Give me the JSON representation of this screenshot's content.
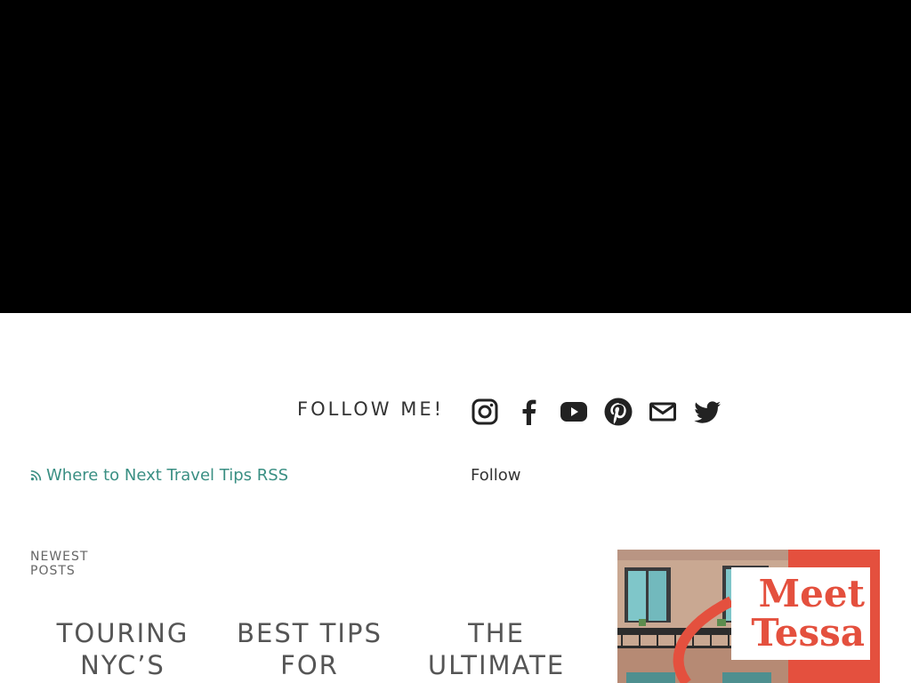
{
  "follow": {
    "heading": "FOLLOW ME!",
    "icons": [
      "instagram-icon",
      "facebook-icon",
      "youtube-icon",
      "pinterest-icon",
      "email-icon",
      "twitter-icon"
    ]
  },
  "rss": {
    "label": "Where to Next Travel Tips RSS",
    "icon": "rss-icon",
    "color": "#3a8f83"
  },
  "follow_link": {
    "label": "Follow"
  },
  "newest_posts": {
    "label_line1": "NEWEST",
    "label_line2": "POSTS",
    "titles": [
      {
        "line1": "TOURING",
        "line2": "NYC’S"
      },
      {
        "line1": "BEST TIPS",
        "line2": "FOR"
      },
      {
        "line1": "THE",
        "line2": "ULTIMATE"
      }
    ]
  },
  "promo": {
    "line1": "Meet",
    "line2": "Tessa",
    "accent": "#e4503e"
  }
}
